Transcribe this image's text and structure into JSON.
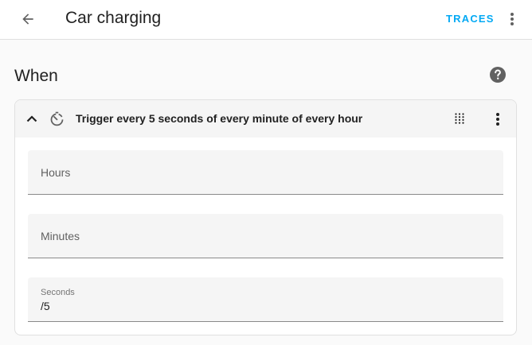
{
  "header": {
    "title": "Car charging",
    "traces_label": "TRACES"
  },
  "section": {
    "title": "When"
  },
  "trigger": {
    "title": "Trigger every 5 seconds of every minute of every hour",
    "fields": [
      {
        "label": "Hours",
        "value": ""
      },
      {
        "label": "Minutes",
        "value": ""
      },
      {
        "label": "Seconds",
        "value": "/5"
      }
    ]
  },
  "colors": {
    "accent": "#03a9f4",
    "icon": "#616161",
    "field_bg": "#f5f5f5"
  },
  "icons": [
    "arrow-left-icon",
    "dots-vertical-icon",
    "help-circle-icon",
    "chevron-up-icon",
    "timer-icon",
    "drag-grid-icon"
  ]
}
